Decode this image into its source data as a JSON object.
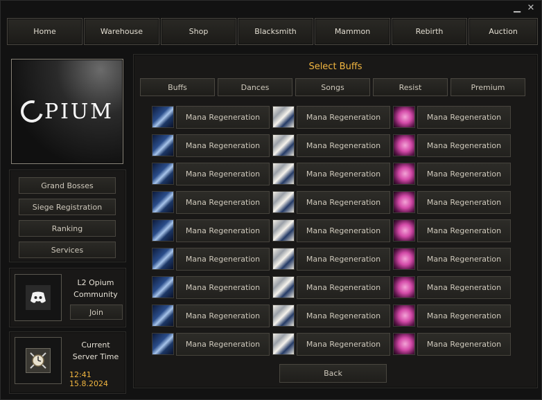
{
  "window_controls": {
    "minimize": "▁",
    "close": "✕"
  },
  "nav": [
    {
      "label": "Home"
    },
    {
      "label": "Warehouse"
    },
    {
      "label": "Shop"
    },
    {
      "label": "Blacksmith"
    },
    {
      "label": "Mammon"
    },
    {
      "label": "Rebirth"
    },
    {
      "label": "Auction"
    }
  ],
  "logo": {
    "text": "PIUM"
  },
  "sidebar": {
    "items": [
      {
        "label": "Grand Bosses"
      },
      {
        "label": "Siege Registration"
      },
      {
        "label": "Ranking"
      },
      {
        "label": "Services"
      }
    ]
  },
  "community": {
    "line1": "L2 Opium",
    "line2": "Community",
    "join_label": "Join",
    "icon": "discord-icon"
  },
  "server_time": {
    "line1": "Current",
    "line2": "Server Time",
    "value": "12:41 15.8.2024",
    "icon": "clock-swords-icon"
  },
  "main": {
    "title": "Select Buffs",
    "categories": [
      {
        "label": "Buffs"
      },
      {
        "label": "Dances"
      },
      {
        "label": "Songs"
      },
      {
        "label": "Resist"
      },
      {
        "label": "Premium"
      }
    ],
    "buff_rows": [
      [
        "Mana Regeneration",
        "Mana Regeneration",
        "Mana Regeneration"
      ],
      [
        "Mana Regeneration",
        "Mana Regeneration",
        "Mana Regeneration"
      ],
      [
        "Mana Regeneration",
        "Mana Regeneration",
        "Mana Regeneration"
      ],
      [
        "Mana Regeneration",
        "Mana Regeneration",
        "Mana Regeneration"
      ],
      [
        "Mana Regeneration",
        "Mana Regeneration",
        "Mana Regeneration"
      ],
      [
        "Mana Regeneration",
        "Mana Regeneration",
        "Mana Regeneration"
      ],
      [
        "Mana Regeneration",
        "Mana Regeneration",
        "Mana Regeneration"
      ],
      [
        "Mana Regeneration",
        "Mana Regeneration",
        "Mana Regeneration"
      ],
      [
        "Mana Regeneration",
        "Mana Regeneration",
        "Mana Regeneration"
      ]
    ],
    "icon_names": [
      "blue-buff-icon",
      "white-buff-icon",
      "pink-buff-icon"
    ],
    "back_label": "Back"
  },
  "colors": {
    "accent": "#f2b640",
    "background": "#121212",
    "border": "#4a4740"
  }
}
